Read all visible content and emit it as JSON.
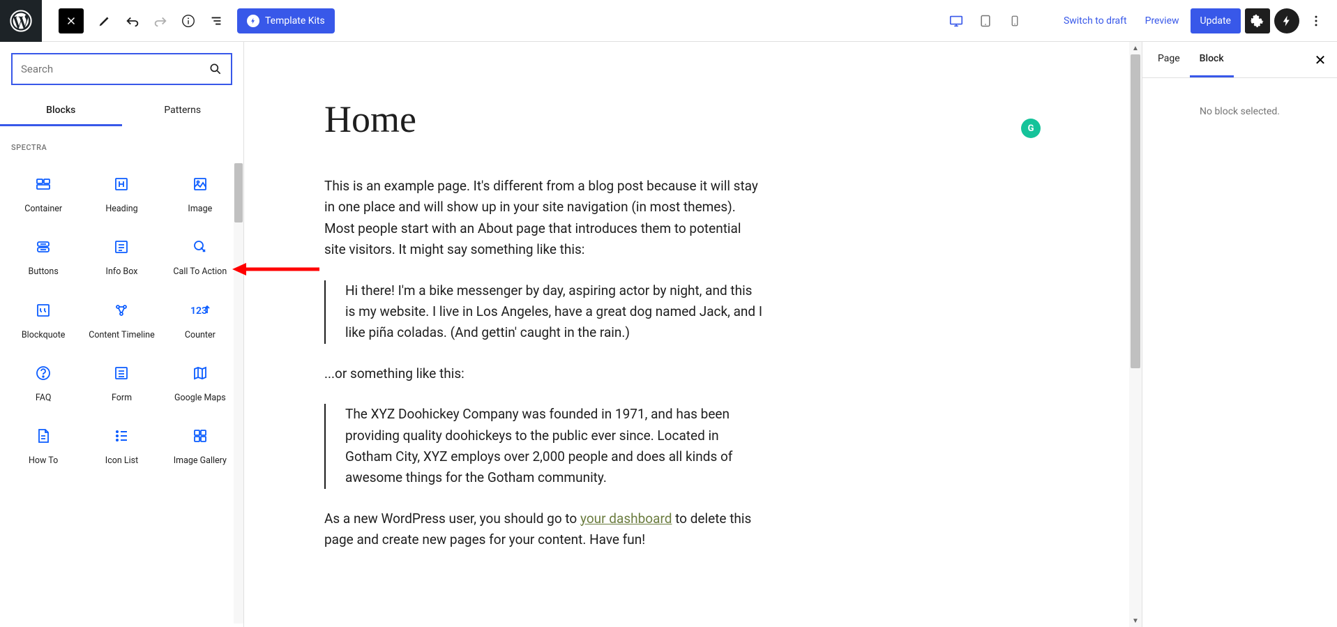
{
  "toolbar": {
    "template_kits_label": "Template Kits",
    "switch_to_draft": "Switch to draft",
    "preview": "Preview",
    "update": "Update"
  },
  "inserter": {
    "search_placeholder": "Search",
    "tabs": {
      "blocks": "Blocks",
      "patterns": "Patterns"
    },
    "category": "SPECTRA",
    "blocks": [
      {
        "label": "Container"
      },
      {
        "label": "Heading"
      },
      {
        "label": "Image"
      },
      {
        "label": "Buttons"
      },
      {
        "label": "Info Box"
      },
      {
        "label": "Call To Action"
      },
      {
        "label": "Blockquote"
      },
      {
        "label": "Content Timeline"
      },
      {
        "label": "Counter"
      },
      {
        "label": "FAQ"
      },
      {
        "label": "Form"
      },
      {
        "label": "Google Maps"
      },
      {
        "label": "How To"
      },
      {
        "label": "Icon List"
      },
      {
        "label": "Image Gallery"
      }
    ]
  },
  "content": {
    "title": "Home",
    "para1": "This is an example page. It's different from a blog post because it will stay in one place and will show up in your site navigation (in most themes). Most people start with an About page that introduces them to potential site visitors. It might say something like this:",
    "quote1": "Hi there! I'm a bike messenger by day, aspiring actor by night, and this is my website. I live in Los Angeles, have a great dog named Jack, and I like piña coladas. (And gettin' caught in the rain.)",
    "para2": "...or something like this:",
    "quote2": "The XYZ Doohickey Company was founded in 1971, and has been providing quality doohickeys to the public ever since. Located in Gotham City, XYZ employs over 2,000 people and does all kinds of awesome things for the Gotham community.",
    "para3_before": "As a new WordPress user, you should go to ",
    "para3_link": "your dashboard",
    "para3_after": " to delete this page and create new pages for your content. Have fun!",
    "grammarly": "G"
  },
  "sidebar": {
    "tabs": {
      "page": "Page",
      "block": "Block"
    },
    "empty": "No block selected."
  }
}
